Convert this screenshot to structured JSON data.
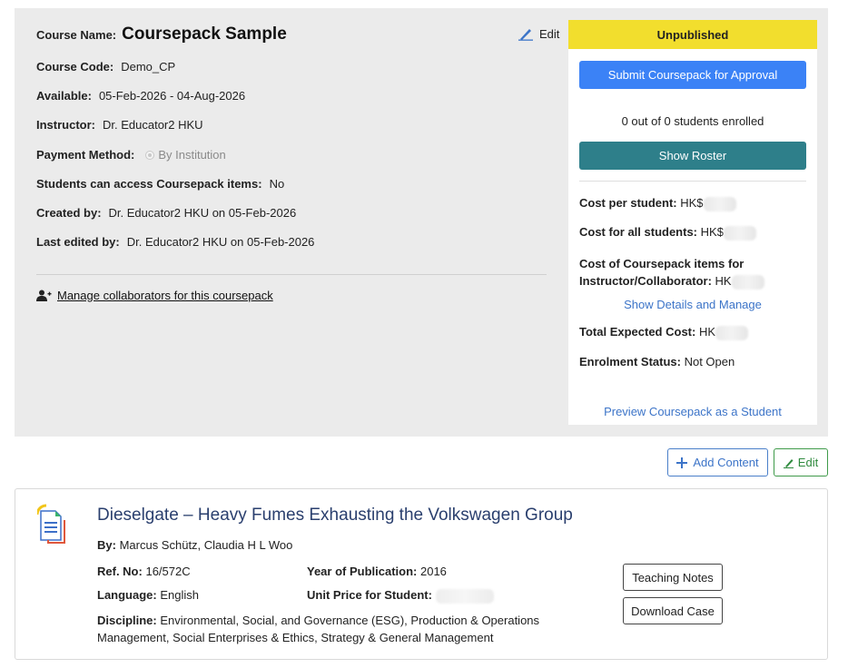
{
  "course": {
    "name_label": "Course Name:",
    "name": "Coursepack Sample",
    "edit_label": "Edit",
    "code_label": "Course Code:",
    "code": "Demo_CP",
    "available_label": "Available:",
    "available": "05-Feb-2026 - 04-Aug-2026",
    "instructor_label": "Instructor:",
    "instructor": "Dr. Educator2 HKU",
    "payment_label": "Payment Method:",
    "payment": "By Institution",
    "access_label": "Students can access Coursepack items:",
    "access": "No",
    "created_label": "Created by:",
    "created": "Dr. Educator2 HKU on 05-Feb-2026",
    "edited_label": "Last edited by:",
    "edited": "Dr. Educator2 HKU on 05-Feb-2026",
    "collab_link": "Manage collaborators for this coursepack"
  },
  "side": {
    "status": "Unpublished",
    "status_color": "#f2de2d",
    "submit_label": "Submit Coursepack for Approval",
    "enrolled": "0 out of 0 students enrolled",
    "roster_label": "Show Roster",
    "cost_per_student_label": "Cost per student:",
    "cost_per_student_prefix": "HK$",
    "cost_all_label": "Cost for all students:",
    "cost_all_prefix": "HK$",
    "cost_items_label_1": "Cost of Coursepack items for",
    "cost_items_label_2": "Instructor/Collaborator:",
    "cost_items_prefix": "HK",
    "details_link": "Show Details and Manage",
    "total_label": "Total Expected Cost:",
    "total_prefix": "HK",
    "enrol_status_label": "Enrolment Status:",
    "enrol_status": "Not Open",
    "preview_link": "Preview Coursepack as a Student"
  },
  "toolbar": {
    "add_content": "Add Content",
    "edit": "Edit"
  },
  "case": {
    "title": "Dieselgate – Heavy Fumes Exhausting the Volkswagen Group",
    "by_label": "By:",
    "by": "Marcus Schütz, Claudia H L Woo",
    "ref_label": "Ref. No:",
    "ref": "16/572C",
    "year_label": "Year of Publication:",
    "year": "2016",
    "language_label": "Language:",
    "language": "English",
    "price_label": "Unit Price for Student:",
    "discipline_label": "Discipline:",
    "discipline": "Environmental, Social, and Governance (ESG), Production & Operations Management, Social Enterprises & Ethics, Strategy & General Management",
    "teaching_notes": "Teaching Notes",
    "download": "Download Case"
  },
  "colors": {
    "primary": "#3b82f6",
    "teal": "#2e7f8a",
    "link": "#3c74c8",
    "title": "#2a3f6e"
  },
  "icons": [
    "pencil-icon",
    "add-user-icon",
    "plus-icon",
    "document-icon"
  ]
}
